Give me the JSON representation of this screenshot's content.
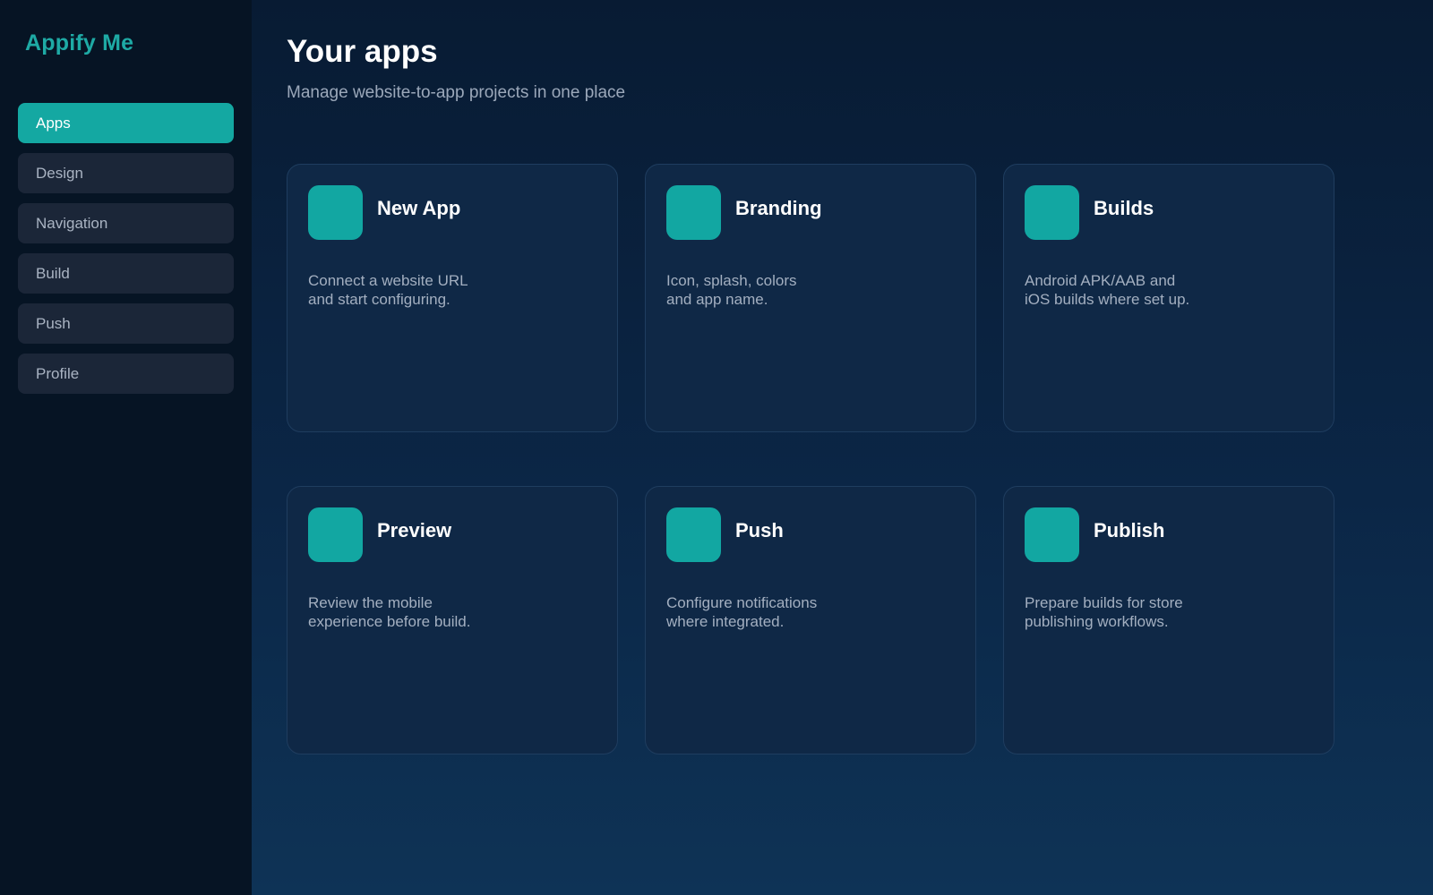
{
  "app": {
    "brand": "Appify Me"
  },
  "sidebar": {
    "items": [
      {
        "label": "Apps",
        "active": true
      },
      {
        "label": "Design",
        "active": false
      },
      {
        "label": "Navigation",
        "active": false
      },
      {
        "label": "Build",
        "active": false
      },
      {
        "label": "Push",
        "active": false
      },
      {
        "label": "Profile",
        "active": false
      }
    ]
  },
  "header": {
    "title": "Your apps",
    "subtitle": "Manage website-to-app projects in one place"
  },
  "cards": [
    {
      "title": "New App",
      "description": "Connect a website URL\nand start configuring."
    },
    {
      "title": "Branding",
      "description": "Icon, splash, colors\nand app name."
    },
    {
      "title": "Builds",
      "description": "Android APK/AAB and\niOS builds where set up."
    },
    {
      "title": "Preview",
      "description": "Review the mobile\nexperience before build."
    },
    {
      "title": "Push",
      "description": "Configure notifications\nwhere integrated."
    },
    {
      "title": "Publish",
      "description": "Prepare builds for store\npublishing workflows."
    }
  ],
  "colors": {
    "accent": "#14a8a2",
    "sidebar_bg": "#061424",
    "card_bg": "#0f2846"
  }
}
